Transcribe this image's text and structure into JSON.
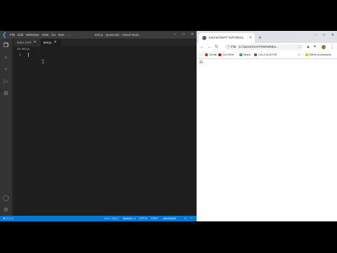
{
  "vscode": {
    "menu": [
      "File",
      "Edit",
      "Selection",
      "View",
      "Go",
      "Run",
      "…"
    ],
    "window_title": "test.js - javascript - Visual Studi...",
    "window_controls": [
      "–",
      "□",
      "✕"
    ],
    "tabs": [
      {
        "label": "index.html",
        "close": "✕"
      },
      {
        "label": "test.js",
        "close": "✕"
      }
    ],
    "breadcrumb": "JS test.js",
    "line_number": "1",
    "status": {
      "remote": "⊗ 0 ⚠ 0",
      "position": "Ln 1, Col 1",
      "spaces": "Spaces: 4",
      "encoding": "UTF-8",
      "eol": "CRLF",
      "language": "JavaScript"
    }
  },
  "chrome": {
    "tab_title": "JAVASCRIPT TUTORIAL",
    "tab_close": "✕",
    "new_tab": "+",
    "window_controls": [
      "–",
      "□",
      "✕"
    ],
    "address_prefix": "File",
    "address": "C:/Users/CUSTOM/WEBU...",
    "bookmarks": [
      {
        "label": "Gmail",
        "color": "#d93025"
      },
      {
        "label": "YouTube",
        "color": "#ff0000"
      },
      {
        "label": "Maps",
        "color": "#34a853"
      },
      {
        "label": "CALCULATOR",
        "color": "#5f6368"
      }
    ],
    "other_bookmarks": "Other bookmarks",
    "page_output": "25"
  }
}
